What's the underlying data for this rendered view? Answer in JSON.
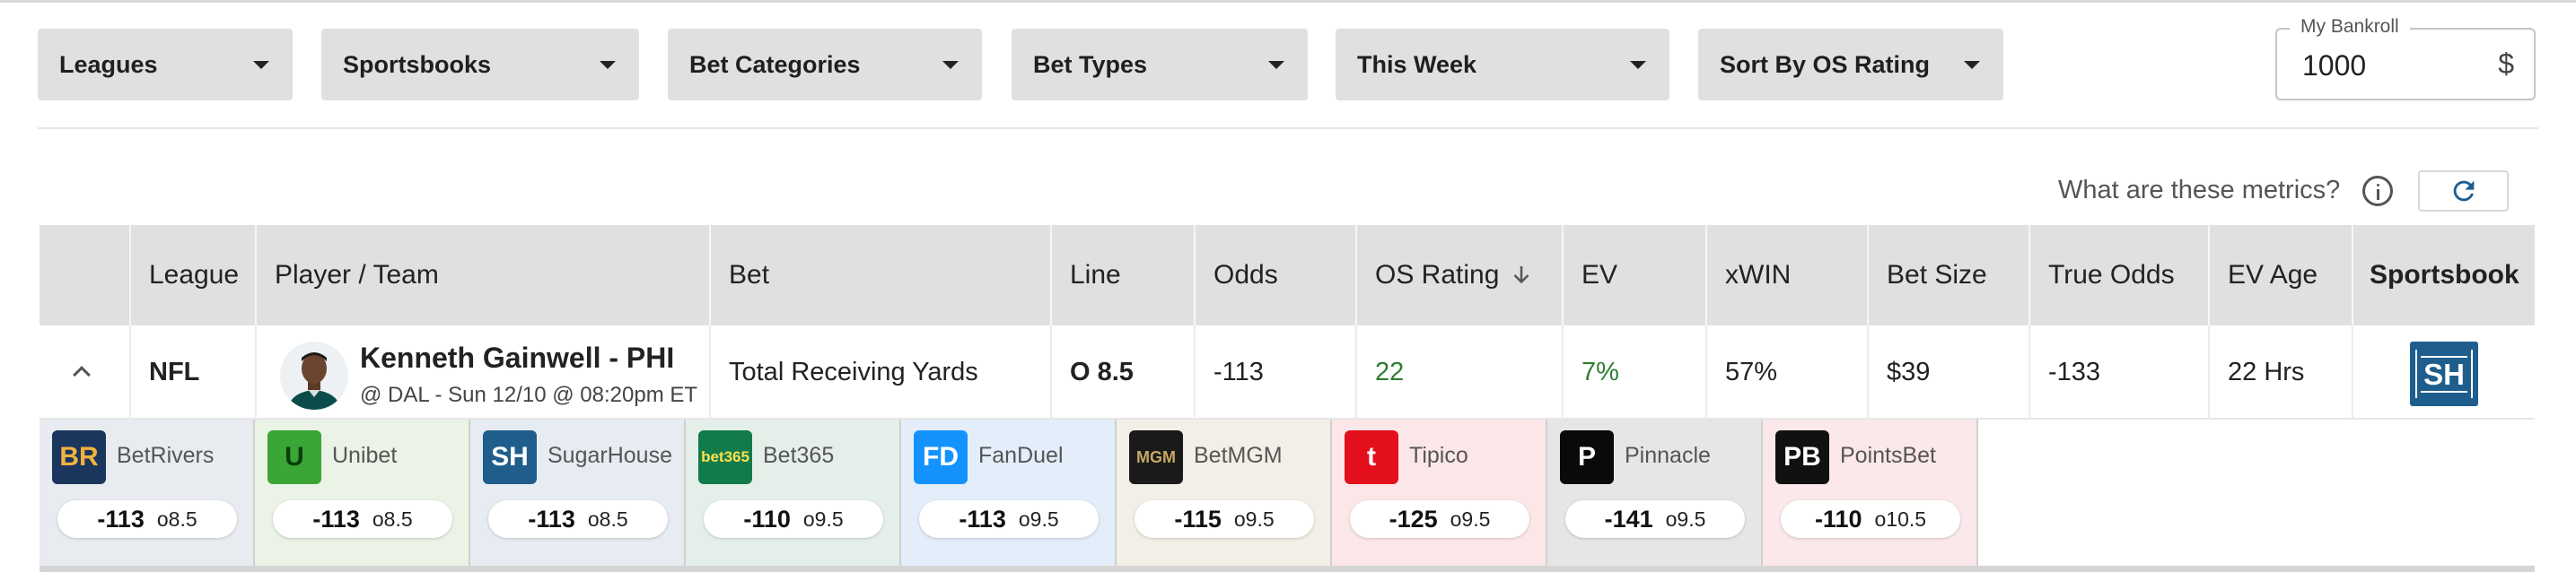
{
  "filters": {
    "leagues": "Leagues",
    "sportsbooks": "Sportsbooks",
    "bet_categories": "Bet Categories",
    "bet_types": "Bet Types",
    "time_range": "This Week",
    "sort": "Sort By OS Rating"
  },
  "bankroll": {
    "label": "My Bankroll",
    "value": "1000",
    "currency": "$"
  },
  "metrics_link": "What are these metrics?",
  "table": {
    "columns": [
      "League",
      "Player / Team",
      "Bet",
      "Line",
      "Odds",
      "OS Rating",
      "EV",
      "xWIN",
      "Bet Size",
      "True Odds",
      "EV Age",
      "Sportsbook"
    ],
    "sorted_column": "OS Rating",
    "sort_direction": "descending",
    "row": {
      "league": "NFL",
      "player": "Kenneth Gainwell - PHI",
      "game": "@ DAL - Sun 12/10 @ 08:20pm ET",
      "bet": "Total Receiving Yards",
      "line": "O 8.5",
      "odds": "-113",
      "os_rating": "22",
      "ev": "7%",
      "xwin": "57%",
      "bet_size": "$39",
      "true_odds": "-133",
      "ev_age": "22 Hrs",
      "sportsbook_logo_text": "SH"
    }
  },
  "books": [
    {
      "name": "BetRivers",
      "logo_text": "BR",
      "odds": "-113",
      "line": "o8.5",
      "bg": "#e8ebf0",
      "logo_bg": "#1b365d",
      "logo_fg": "#f2b33d"
    },
    {
      "name": "Unibet",
      "logo_text": "U",
      "odds": "-113",
      "line": "o8.5",
      "bg": "#eaf3e6",
      "logo_bg": "#3aa635",
      "logo_fg": "#0b3d0b"
    },
    {
      "name": "SugarHouse",
      "logo_text": "SH",
      "odds": "-113",
      "line": "o8.5",
      "bg": "#e6ecf2",
      "logo_bg": "#1f5d8d",
      "logo_fg": "#ffffff"
    },
    {
      "name": "Bet365",
      "logo_text": "bet365",
      "odds": "-110",
      "line": "o9.5",
      "bg": "#e5efe9",
      "logo_bg": "#127a4b",
      "logo_fg": "#ffe14d"
    },
    {
      "name": "FanDuel",
      "logo_text": "FD",
      "odds": "-113",
      "line": "o9.5",
      "bg": "#e3eefa",
      "logo_bg": "#1493ff",
      "logo_fg": "#ffffff"
    },
    {
      "name": "BetMGM",
      "logo_text": "MGM",
      "odds": "-115",
      "line": "o9.5",
      "bg": "#f2efe6",
      "logo_bg": "#1a1a1a",
      "logo_fg": "#c8a862"
    },
    {
      "name": "Tipico",
      "logo_text": "t",
      "odds": "-125",
      "line": "o9.5",
      "bg": "#fbe6e8",
      "logo_bg": "#e30f1c",
      "logo_fg": "#ffffff"
    },
    {
      "name": "Pinnacle",
      "logo_text": "P",
      "odds": "-141",
      "line": "o9.5",
      "bg": "#e6e6e6",
      "logo_bg": "#0a0a0a",
      "logo_fg": "#ffffff"
    },
    {
      "name": "PointsBet",
      "logo_text": "PB",
      "odds": "-110",
      "line": "o10.5",
      "bg": "#fbe8ea",
      "logo_bg": "#111111",
      "logo_fg": "#ffffff"
    }
  ],
  "icons": {
    "dropdown": "caret-down-icon",
    "info": "info-icon",
    "refresh": "refresh-icon",
    "sort": "arrow-down-icon",
    "collapse": "chevron-up-icon"
  },
  "colors": {
    "positive": "#2e7d32",
    "header_bg": "#e0e0e0",
    "refresh": "#1f5d8d"
  }
}
